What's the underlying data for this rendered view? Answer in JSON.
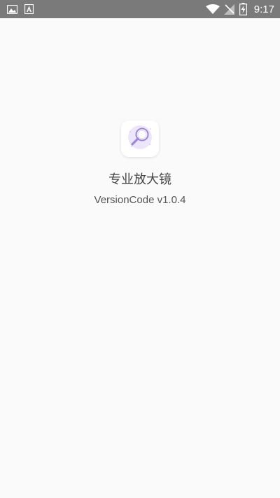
{
  "status_bar": {
    "time": "9:17",
    "left_icons": [
      "image-icon",
      "text-a-icon"
    ],
    "right_icons": [
      "wifi-icon",
      "no-signal-icon",
      "battery-charging-icon"
    ]
  },
  "app": {
    "name": "专业放大镜",
    "version_label": "VersionCode",
    "version_value": "v1.0.4",
    "icon": "magnifier-icon"
  },
  "colors": {
    "status_bar_bg": "#7a7a7a",
    "page_bg": "#fafafa",
    "icon_accent": "#c9b8f0"
  }
}
